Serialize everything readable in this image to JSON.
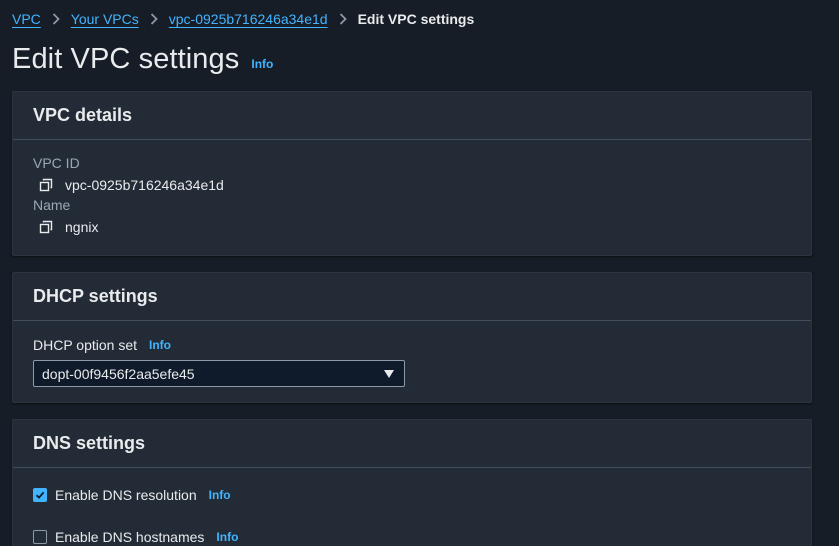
{
  "breadcrumb": {
    "items": [
      {
        "label": "VPC"
      },
      {
        "label": "Your VPCs"
      },
      {
        "label": "vpc-0925b716246a34e1d"
      }
    ],
    "current": "Edit VPC settings"
  },
  "page": {
    "title": "Edit VPC settings",
    "info_label": "Info"
  },
  "vpc_details": {
    "heading": "VPC details",
    "vpc_id_label": "VPC ID",
    "vpc_id_value": "vpc-0925b716246a34e1d",
    "name_label": "Name",
    "name_value": "ngnix"
  },
  "dhcp_settings": {
    "heading": "DHCP settings",
    "option_set_label": "DHCP option set",
    "info_label": "Info",
    "selected_value": "dopt-00f9456f2aa5efe45"
  },
  "dns_settings": {
    "heading": "DNS settings",
    "resolution": {
      "label": "Enable DNS resolution",
      "info_label": "Info",
      "checked": true
    },
    "hostnames": {
      "label": "Enable DNS hostnames",
      "info_label": "Info",
      "checked": false
    }
  },
  "colors": {
    "background": "#161d26",
    "panel": "#232b36",
    "link": "#42b4ff",
    "text": "#e9ebed",
    "muted": "#9ba7b6"
  },
  "icons": {
    "copy": "copy-icon",
    "chevron": "chevron-right-icon",
    "caret": "caret-down-icon",
    "check": "check-icon"
  }
}
